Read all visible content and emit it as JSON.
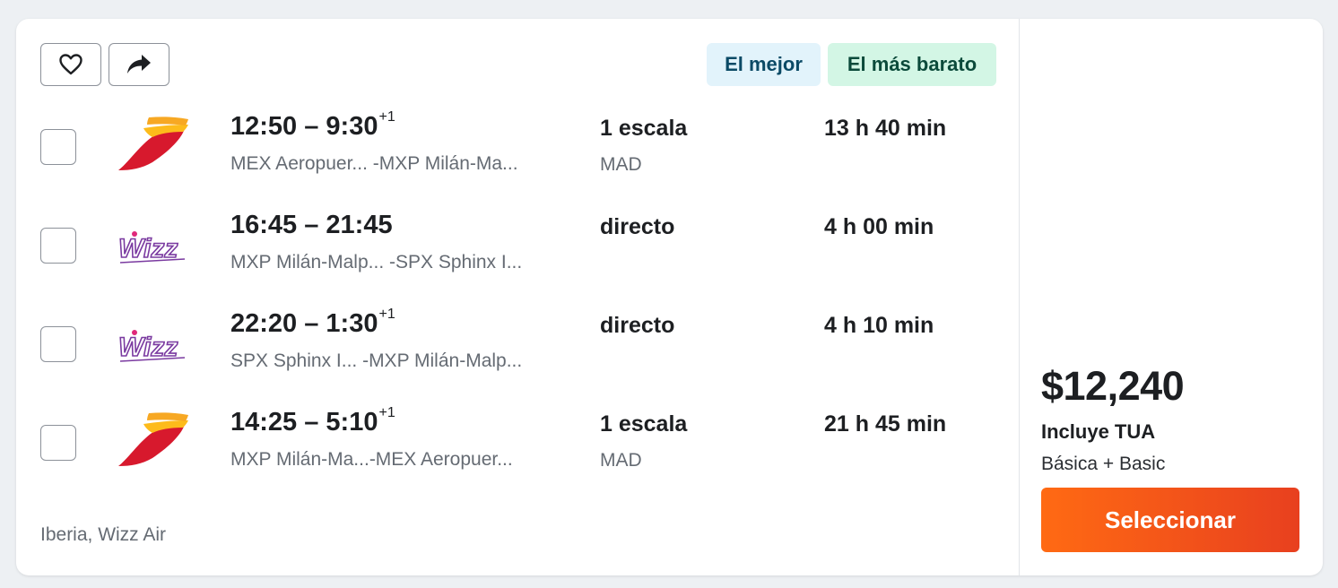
{
  "actions": {
    "favorite_icon": "heart-icon",
    "share_icon": "share-arrow-icon"
  },
  "badges": {
    "best": "El mejor",
    "cheapest": "El más barato"
  },
  "flights": [
    {
      "airline": "Iberia",
      "logo": "iberia-logo",
      "time": "12:50 – 9:30",
      "day_offset": "+1",
      "route": "MEX Aeropuer... -MXP Milán-Ma...",
      "stops": "1 escala",
      "via": "MAD",
      "duration": "13 h 40 min"
    },
    {
      "airline": "Wizz Air",
      "logo": "wizz-logo",
      "time": "16:45 – 21:45",
      "day_offset": "",
      "route": "MXP Milán-Malp... -SPX Sphinx I...",
      "stops": "directo",
      "via": "",
      "duration": "4 h 00 min"
    },
    {
      "airline": "Wizz Air",
      "logo": "wizz-logo",
      "time": "22:20 – 1:30",
      "day_offset": "+1",
      "route": "SPX Sphinx I... -MXP Milán-Malp...",
      "stops": "directo",
      "via": "",
      "duration": "4 h 10 min"
    },
    {
      "airline": "Iberia",
      "logo": "iberia-logo",
      "time": "14:25 – 5:10",
      "day_offset": "+1",
      "route": "MXP Milán-Ma...-MEX Aeropuer...",
      "stops": "1 escala",
      "via": "MAD",
      "duration": "21 h 45 min"
    }
  ],
  "airlines_summary": "Iberia, Wizz Air",
  "pricing": {
    "price": "$12,240",
    "includes": "Incluye TUA",
    "fare_type": "Básica + Basic",
    "select_label": "Seleccionar"
  },
  "colors": {
    "accent": "#ff6a13",
    "accent_end": "#e8401f",
    "badge_best_bg": "#e2f3fb",
    "badge_cheap_bg": "#d3f6e5"
  }
}
